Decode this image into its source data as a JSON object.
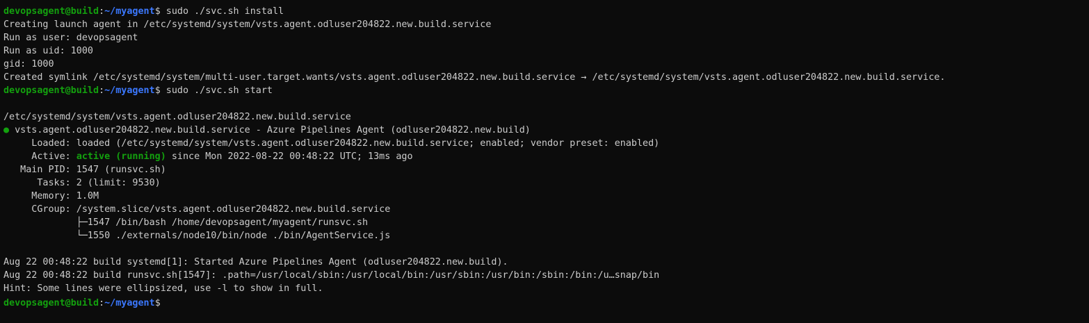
{
  "prompt": {
    "user_host": "devopsagent@build",
    "path": "~/myagent",
    "symbol": "$"
  },
  "commands": {
    "install": " sudo ./svc.sh install",
    "start": " sudo ./svc.sh start"
  },
  "install_output": [
    "Creating launch agent in /etc/systemd/system/vsts.agent.odluser204822.new.build.service",
    "Run as user: devopsagent",
    "Run as uid: 1000",
    "gid: 1000",
    "Created symlink /etc/systemd/system/multi-user.target.wants/vsts.agent.odluser204822.new.build.service → /etc/systemd/system/vsts.agent.odluser204822.new.build.service."
  ],
  "status": {
    "unit_path": "/etc/systemd/system/vsts.agent.odluser204822.new.build.service",
    "bullet": "●",
    "header": " vsts.agent.odluser204822.new.build.service - Azure Pipelines Agent (odluser204822.new.build)",
    "loaded": "     Loaded: loaded (/etc/systemd/system/vsts.agent.odluser204822.new.build.service; enabled; vendor preset: enabled)",
    "active_label": "     Active: ",
    "active_state": "active (running)",
    "active_rest": " since Mon 2022-08-22 00:48:22 UTC; 13ms ago",
    "main_pid": "   Main PID: 1547 (runsvc.sh)",
    "tasks": "      Tasks: 2 (limit: 9530)",
    "memory": "     Memory: 1.0M",
    "cgroup": "     CGroup: /system.slice/vsts.agent.odluser204822.new.build.service",
    "cgroup_child_1": "             ├─1547 /bin/bash /home/devopsagent/myagent/runsvc.sh",
    "cgroup_child_2": "             └─1550 ./externals/node10/bin/node ./bin/AgentService.js"
  },
  "journal": [
    "Aug 22 00:48:22 build systemd[1]: Started Azure Pipelines Agent (odluser204822.new.build).",
    "Aug 22 00:48:22 build runsvc.sh[1547]: .path=/usr/local/sbin:/usr/local/bin:/usr/sbin:/usr/bin:/sbin:/bin:/u…snap/bin",
    "Hint: Some lines were ellipsized, use -l to show in full."
  ],
  "colors": {
    "background": "#0c0c0c",
    "foreground": "#cccccc",
    "prompt_green": "#13a10e",
    "prompt_blue": "#3b78ff"
  }
}
